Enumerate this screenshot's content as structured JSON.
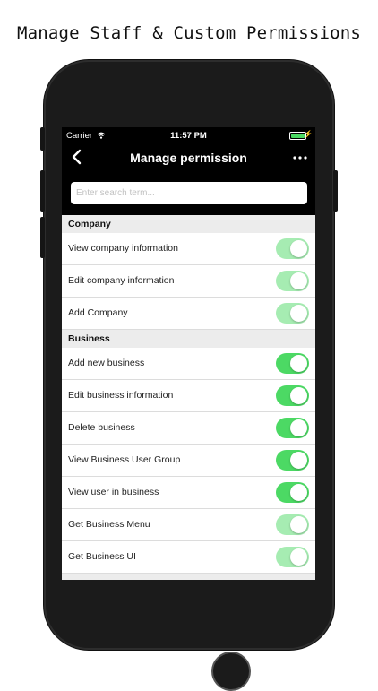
{
  "caption": "Manage Staff & Custom Permissions",
  "status_bar": {
    "carrier": "Carrier",
    "time": "11:57 PM",
    "battery_level": 1.0
  },
  "nav": {
    "title": "Manage permission",
    "back_icon": "chevron-left-icon",
    "more_icon": "ellipsis-icon"
  },
  "search": {
    "placeholder": "Enter search term...",
    "value": ""
  },
  "colors": {
    "switch_on": "#4cd964",
    "switch_on_disabled": "#a6ecb2",
    "bar_bg": "#000000"
  },
  "sections": [
    {
      "title": "Company",
      "items": [
        {
          "label": "View company information",
          "enabled": true,
          "editable": false
        },
        {
          "label": "Edit company information",
          "enabled": true,
          "editable": false
        },
        {
          "label": "Add Company",
          "enabled": true,
          "editable": false
        }
      ]
    },
    {
      "title": "Business",
      "items": [
        {
          "label": "Add new business",
          "enabled": true,
          "editable": true
        },
        {
          "label": "Edit business information",
          "enabled": true,
          "editable": true
        },
        {
          "label": "Delete business",
          "enabled": true,
          "editable": true
        },
        {
          "label": "View Business User Group",
          "enabled": true,
          "editable": true
        },
        {
          "label": "View user in business",
          "enabled": true,
          "editable": true
        },
        {
          "label": "Get Business Menu",
          "enabled": true,
          "editable": false
        },
        {
          "label": "Get Business UI",
          "enabled": true,
          "editable": false
        }
      ]
    }
  ]
}
